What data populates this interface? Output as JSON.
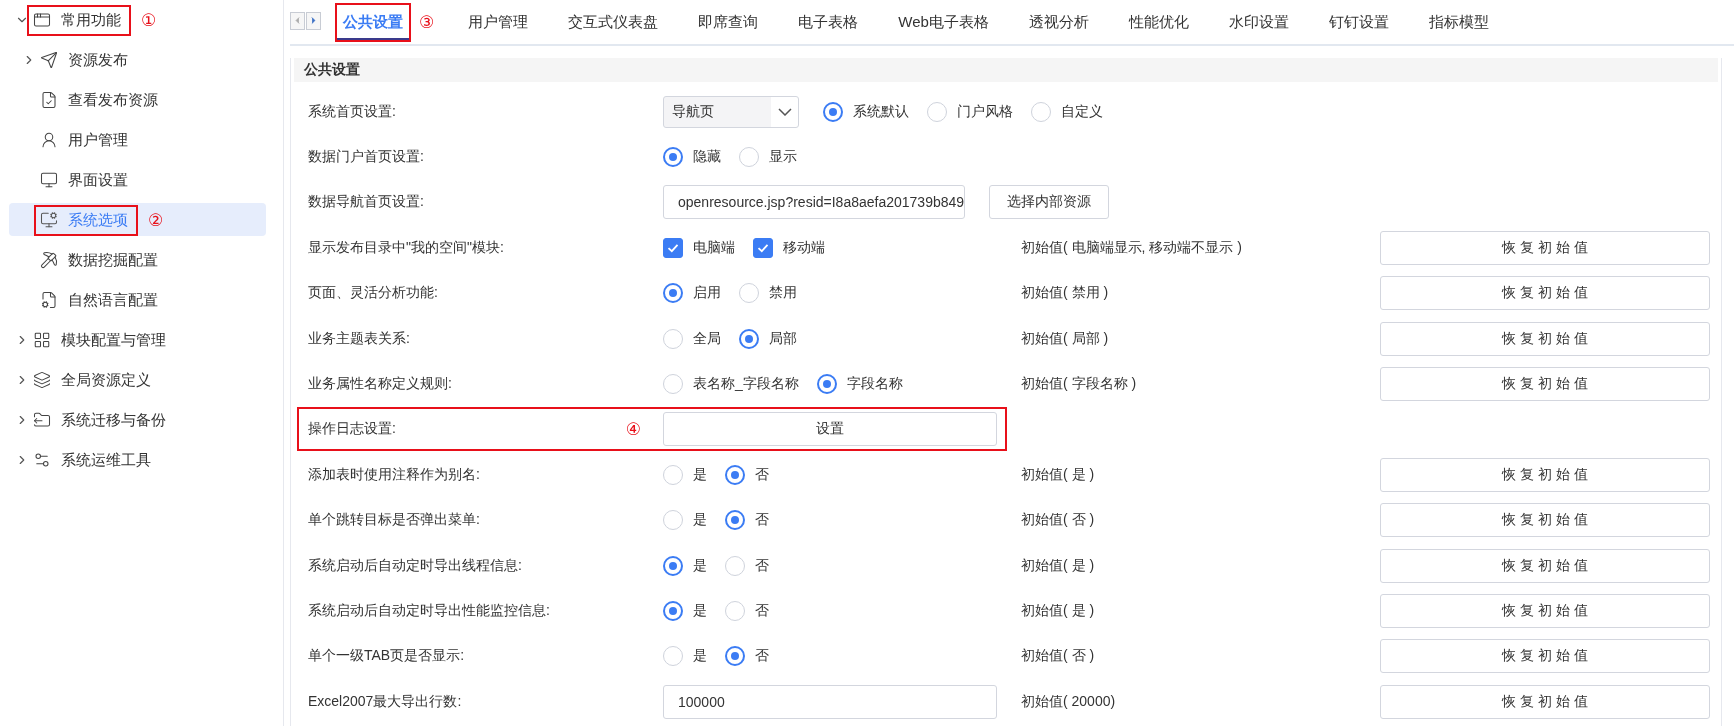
{
  "sidebar": {
    "items": [
      {
        "label": "常用功能",
        "expanded": true,
        "selected": false,
        "annotation": "①",
        "children": [
          {
            "label": "资源发布",
            "expanded": false,
            "selected": false
          },
          {
            "label": "查看发布资源",
            "selected": false
          },
          {
            "label": "用户管理",
            "selected": false
          },
          {
            "label": "界面设置",
            "selected": false
          },
          {
            "label": "系统选项",
            "selected": true,
            "annotation": "②"
          },
          {
            "label": "数据挖掘配置",
            "selected": false
          },
          {
            "label": "自然语言配置",
            "selected": false
          }
        ]
      },
      {
        "label": "模块配置与管理",
        "expanded": false,
        "selected": false
      },
      {
        "label": "全局资源定义",
        "expanded": false,
        "selected": false
      },
      {
        "label": "系统迁移与备份",
        "expanded": false,
        "selected": false
      },
      {
        "label": "系统运维工具",
        "expanded": false,
        "selected": false
      }
    ]
  },
  "tabs": [
    {
      "label": "公共设置",
      "selected": true,
      "annotation": "③"
    },
    {
      "label": "用户管理",
      "selected": false
    },
    {
      "label": "交互式仪表盘",
      "selected": false
    },
    {
      "label": "即席查询",
      "selected": false
    },
    {
      "label": "电子表格",
      "selected": false
    },
    {
      "label": "Web电子表格",
      "selected": false
    },
    {
      "label": "透视分析",
      "selected": false
    },
    {
      "label": "性能优化",
      "selected": false
    },
    {
      "label": "水印设置",
      "selected": false
    },
    {
      "label": "钉钉设置",
      "selected": false
    },
    {
      "label": "指标模型",
      "selected": false
    }
  ],
  "section": {
    "title": "公共设置"
  },
  "rows": [
    {
      "label": "系统首页设置:",
      "kind": "select_radio",
      "select": {
        "value": "导航页"
      },
      "options": [
        {
          "label": "系统默认",
          "selected": true
        },
        {
          "label": "门户风格",
          "selected": false
        },
        {
          "label": "自定义",
          "selected": false
        }
      ]
    },
    {
      "label": "数据门户首页设置:",
      "kind": "radio",
      "options": [
        {
          "label": "隐藏",
          "selected": true
        },
        {
          "label": "显示",
          "selected": false
        }
      ]
    },
    {
      "label": "数据导航首页设置:",
      "kind": "input_button",
      "input": {
        "value": "openresource.jsp?resid=I8a8aefa201739b849"
      },
      "button": "选择内部资源"
    },
    {
      "label": "显示发布目录中\"我的空间\"模块:",
      "kind": "checkbox",
      "checks": [
        {
          "label": "电脑端",
          "checked": true
        },
        {
          "label": "移动端",
          "checked": true
        }
      ],
      "initial": "初始值( 电脑端显示, 移动端不显示 )",
      "restore": "恢 复 初 始 值"
    },
    {
      "label": "页面、灵活分析功能:",
      "kind": "radio",
      "options": [
        {
          "label": "启用",
          "selected": true
        },
        {
          "label": "禁用",
          "selected": false
        }
      ],
      "initial": "初始值( 禁用 )",
      "restore": "恢 复 初 始 值"
    },
    {
      "label": "业务主题表关系:",
      "kind": "radio",
      "options": [
        {
          "label": "全局",
          "selected": false
        },
        {
          "label": "局部",
          "selected": true
        }
      ],
      "initial": "初始值( 局部 )",
      "restore": "恢 复 初 始 值"
    },
    {
      "label": "业务属性名称定义规则:",
      "kind": "radio",
      "options": [
        {
          "label": "表名称_字段名称",
          "selected": false
        },
        {
          "label": "字段名称",
          "selected": true
        }
      ],
      "initial": "初始值( 字段名称 )",
      "restore": "恢 复 初 始 值"
    },
    {
      "label": "操作日志设置:",
      "kind": "button",
      "button": "设置",
      "annotation": "④"
    },
    {
      "label": "添加表时使用注释作为别名:",
      "kind": "radio",
      "options": [
        {
          "label": "是",
          "selected": false
        },
        {
          "label": "否",
          "selected": true
        }
      ],
      "initial": "初始值( 是 )",
      "restore": "恢 复 初 始 值"
    },
    {
      "label": "单个跳转目标是否弹出菜单:",
      "kind": "radio",
      "options": [
        {
          "label": "是",
          "selected": false
        },
        {
          "label": "否",
          "selected": true
        }
      ],
      "initial": "初始值( 否 )",
      "restore": "恢 复 初 始 值"
    },
    {
      "label": "系统启动后自动定时导出线程信息:",
      "kind": "radio",
      "options": [
        {
          "label": "是",
          "selected": true
        },
        {
          "label": "否",
          "selected": false
        }
      ],
      "initial": "初始值( 是 )",
      "restore": "恢 复 初 始 值"
    },
    {
      "label": "系统启动后自动定时导出性能监控信息:",
      "kind": "radio",
      "options": [
        {
          "label": "是",
          "selected": true
        },
        {
          "label": "否",
          "selected": false
        }
      ],
      "initial": "初始值( 是 )",
      "restore": "恢 复 初 始 值"
    },
    {
      "label": "单个一级TAB页是否显示:",
      "kind": "radio",
      "options": [
        {
          "label": "是",
          "selected": false
        },
        {
          "label": "否",
          "selected": true
        }
      ],
      "initial": "初始值( 否 )",
      "restore": "恢 复 初 始 值"
    },
    {
      "label": "Excel2007最大导出行数:",
      "kind": "input",
      "input": {
        "value": "100000"
      },
      "initial": "初始值( 20000)",
      "restore": "恢 复 初 始 值"
    }
  ]
}
